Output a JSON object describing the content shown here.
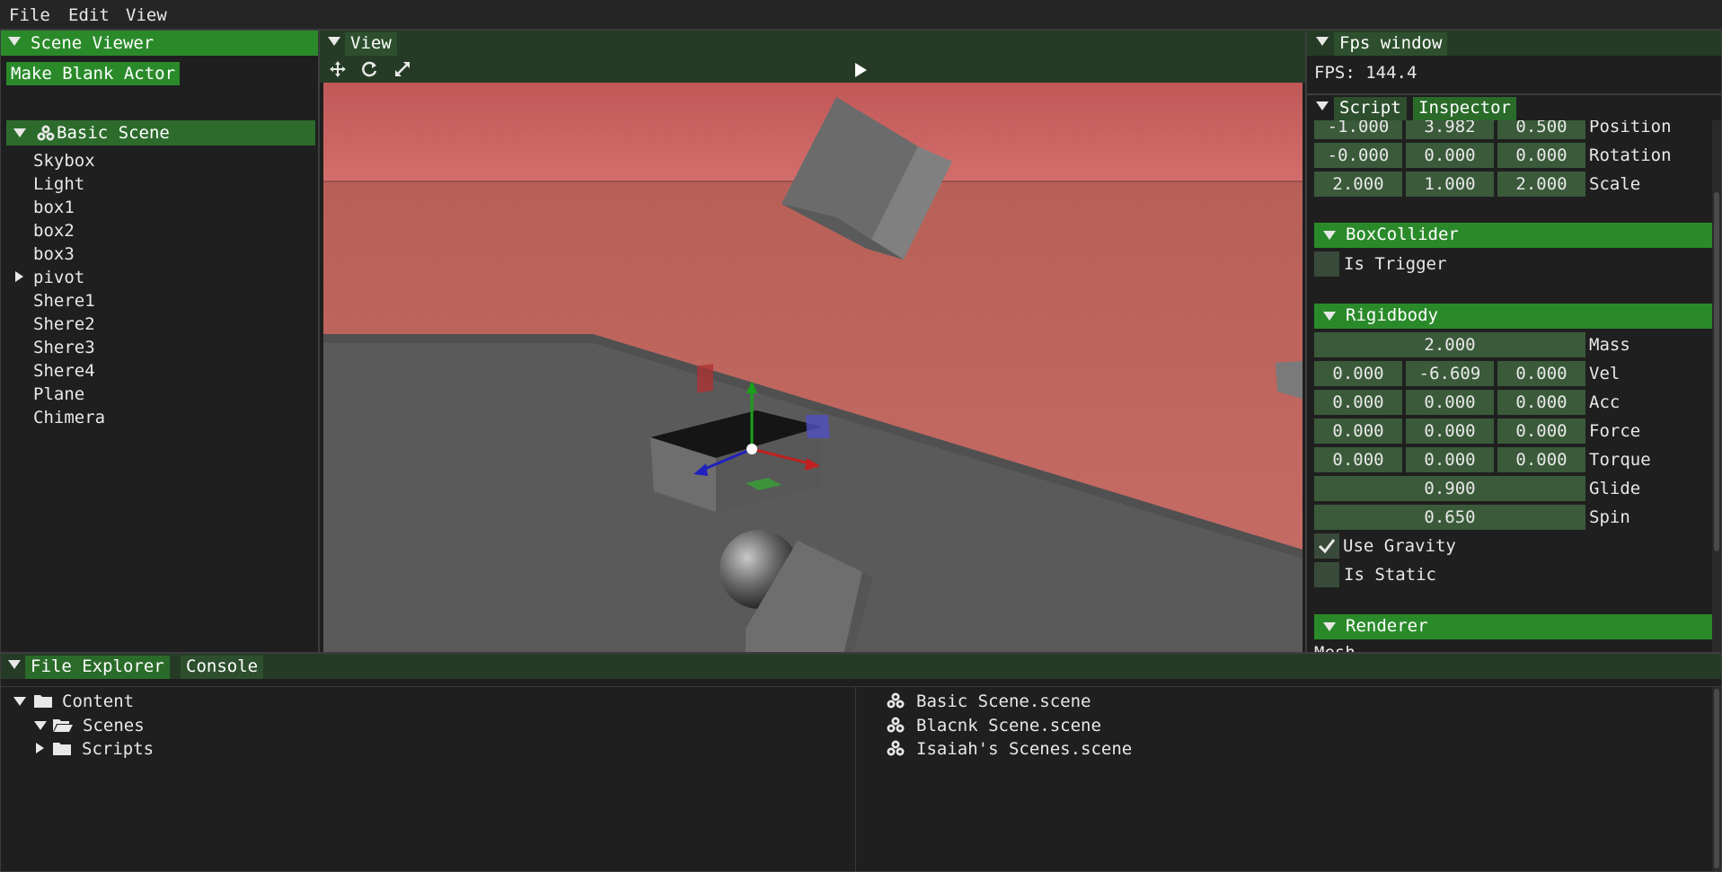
{
  "menu": [
    "File",
    "Edit",
    "View"
  ],
  "scene_viewer": {
    "title": "Scene Viewer",
    "make_blank_actor": "Make Blank Actor",
    "root": "Basic Scene",
    "items": [
      "Skybox",
      "Light",
      "box1",
      "box2",
      "box3",
      "pivot",
      "Shere1",
      "Shere2",
      "Shere3",
      "Shere4",
      "Plane",
      "Chimera"
    ]
  },
  "view": {
    "title": "View"
  },
  "fps_window": {
    "title": "Fps window",
    "fps_text": "FPS: 144.4"
  },
  "inspector": {
    "tabs": [
      "Script",
      "Inspector"
    ],
    "transform": [
      {
        "label": "Position",
        "values": [
          "-1.000",
          "3.982",
          "0.500"
        ]
      },
      {
        "label": "Rotation",
        "values": [
          "-0.000",
          "0.000",
          "0.000"
        ]
      },
      {
        "label": "Scale",
        "values": [
          "2.000",
          "1.000",
          "2.000"
        ]
      }
    ],
    "box_collider": {
      "title": "BoxCollider",
      "is_trigger": "Is Trigger"
    },
    "rigidbody": {
      "title": "Rigidbody",
      "mass": {
        "label": "Mass",
        "value": "2.000"
      },
      "vectors": [
        {
          "label": "Vel",
          "values": [
            "0.000",
            "-6.609",
            "0.000"
          ]
        },
        {
          "label": "Acc",
          "values": [
            "0.000",
            "0.000",
            "0.000"
          ]
        },
        {
          "label": "Force",
          "values": [
            "0.000",
            "0.000",
            "0.000"
          ]
        },
        {
          "label": "Torque",
          "values": [
            "0.000",
            "0.000",
            "0.000"
          ]
        }
      ],
      "glide": {
        "label": "Glide",
        "value": "0.900"
      },
      "spin": {
        "label": "Spin",
        "value": "0.650"
      },
      "use_gravity": "Use Gravity",
      "is_static": "Is Static"
    },
    "renderer": {
      "title": "Renderer",
      "mesh": "Mesh"
    }
  },
  "bottom": {
    "tabs": [
      "File Explorer",
      "Console"
    ],
    "tree": {
      "root": "Content",
      "scenes": "Scenes",
      "scripts": "Scripts"
    },
    "files": [
      "Basic Scene.scene",
      "Blacnk Scene.scene",
      "Isaiah's Scenes.scene"
    ]
  },
  "colors": {
    "accent_green": "#2a8a2a",
    "sky_red": "#c85a5a",
    "floor": "#555555"
  }
}
